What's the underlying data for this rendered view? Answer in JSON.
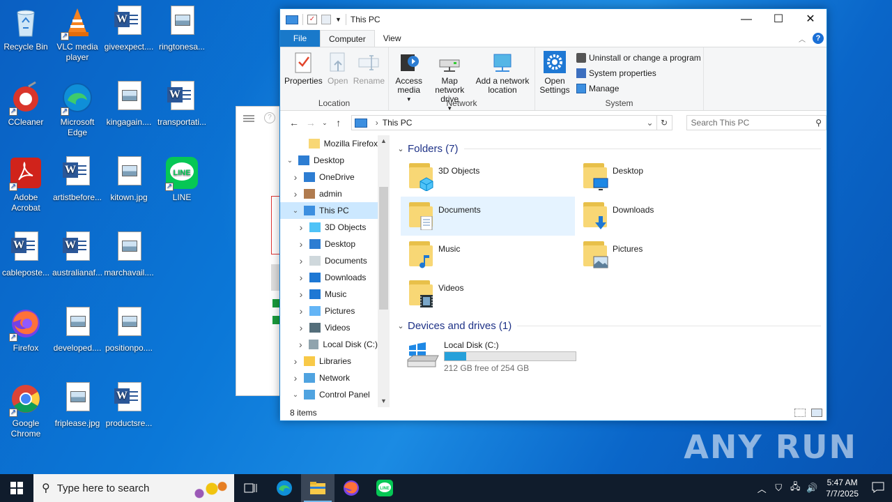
{
  "desktop": {
    "icons": [
      {
        "label": "Recycle Bin",
        "icon": "recycle-bin-icon"
      },
      {
        "label": "VLC media player",
        "icon": "vlc-icon"
      },
      {
        "label": "giveexpect....",
        "icon": "word-doc-icon"
      },
      {
        "label": "ringtonesa...",
        "icon": "image-file-icon"
      },
      {
        "label": "CCleaner",
        "icon": "ccleaner-icon"
      },
      {
        "label": "Microsoft Edge",
        "icon": "edge-icon"
      },
      {
        "label": "kingagain....",
        "icon": "image-file-icon"
      },
      {
        "label": "transportati...",
        "icon": "word-doc-icon"
      },
      {
        "label": "Adobe Acrobat",
        "icon": "acrobat-icon"
      },
      {
        "label": "artistbefore...",
        "icon": "word-doc-icon"
      },
      {
        "label": "kitown.jpg",
        "icon": "image-file-icon"
      },
      {
        "label": "LINE",
        "icon": "line-icon"
      },
      {
        "label": "cableposte...",
        "icon": "word-doc-icon"
      },
      {
        "label": "australianaf...",
        "icon": "word-doc-icon"
      },
      {
        "label": "marchavail....",
        "icon": "image-file-icon"
      },
      {
        "label": "Firefox",
        "icon": "firefox-icon"
      },
      {
        "label": "developed....",
        "icon": "image-file-icon"
      },
      {
        "label": "positionpo....",
        "icon": "image-file-icon"
      },
      {
        "label": "Google Chrome",
        "icon": "chrome-icon"
      },
      {
        "label": "friplease.jpg",
        "icon": "image-file-icon"
      },
      {
        "label": "productsre...",
        "icon": "word-doc-icon"
      }
    ]
  },
  "explorer": {
    "title": "This PC",
    "tabs": {
      "file": "File",
      "computer": "Computer",
      "view": "View"
    },
    "ribbon": {
      "location": {
        "label": "Location",
        "properties": "Properties",
        "open": "Open",
        "rename": "Rename"
      },
      "network": {
        "label": "Network",
        "access_media": "Access media",
        "map_drive": "Map network drive",
        "add_location": "Add a network location"
      },
      "system": {
        "label": "System",
        "open_settings": "Open Settings",
        "uninstall": "Uninstall or change a program",
        "system_properties": "System properties",
        "manage": "Manage"
      }
    },
    "address": {
      "path": "This PC",
      "search_placeholder": "Search This PC"
    },
    "nav": [
      {
        "label": "Mozilla Firefox",
        "level": 2,
        "arrow": ""
      },
      {
        "label": "Desktop",
        "level": 0,
        "arrow": "down"
      },
      {
        "label": "OneDrive",
        "level": 1,
        "arrow": "right"
      },
      {
        "label": "admin",
        "level": 1,
        "arrow": "right"
      },
      {
        "label": "This PC",
        "level": 1,
        "arrow": "down",
        "selected": true
      },
      {
        "label": "3D Objects",
        "level": 2,
        "arrow": "right"
      },
      {
        "label": "Desktop",
        "level": 2,
        "arrow": "right"
      },
      {
        "label": "Documents",
        "level": 2,
        "arrow": "right"
      },
      {
        "label": "Downloads",
        "level": 2,
        "arrow": "right"
      },
      {
        "label": "Music",
        "level": 2,
        "arrow": "right"
      },
      {
        "label": "Pictures",
        "level": 2,
        "arrow": "right"
      },
      {
        "label": "Videos",
        "level": 2,
        "arrow": "right"
      },
      {
        "label": "Local Disk (C:)",
        "level": 2,
        "arrow": "right"
      },
      {
        "label": "Libraries",
        "level": 1,
        "arrow": "right"
      },
      {
        "label": "Network",
        "level": 1,
        "arrow": "right"
      },
      {
        "label": "Control Panel",
        "level": 1,
        "arrow": "down"
      }
    ],
    "folders_header": "Folders (7)",
    "folders": [
      {
        "label": "3D Objects",
        "overlay": "cube"
      },
      {
        "label": "Desktop",
        "overlay": "monitor"
      },
      {
        "label": "Documents",
        "overlay": "doc",
        "selected": true
      },
      {
        "label": "Downloads",
        "overlay": "arrow"
      },
      {
        "label": "Music",
        "overlay": "note"
      },
      {
        "label": "Pictures",
        "overlay": "picture"
      },
      {
        "label": "Videos",
        "overlay": "film"
      }
    ],
    "devices_header": "Devices and drives (1)",
    "drive": {
      "label": "Local Disk (C:)",
      "free": "212 GB free of 254 GB",
      "used_fraction": 0.165
    },
    "status": "8 items"
  },
  "taskbar": {
    "search_placeholder": "Type here to search",
    "time": "5:47 AM",
    "date": "7/7/2025"
  },
  "watermark": "ANY RUN",
  "colors": {
    "accent": "#1979ca",
    "selection": "#cce8ff",
    "taskbar": "#101c2c"
  }
}
